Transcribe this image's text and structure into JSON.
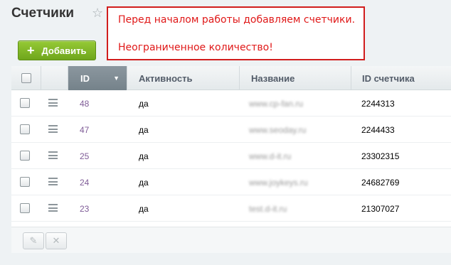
{
  "page": {
    "title": "Счетчики",
    "star_icon": "star-icon"
  },
  "callout": {
    "line1": "Перед началом работы добавляем счетчики.",
    "line2": "Неограниченное количество!"
  },
  "toolbar": {
    "add_label": "Добавить",
    "add_icon": "plus-icon"
  },
  "table": {
    "columns": [
      "ID",
      "Активность",
      "Название",
      "ID счетчика"
    ],
    "sorted_column": "ID",
    "rows": [
      {
        "id": "48",
        "active": "да",
        "name": "www.cp-fan.ru",
        "counter_id": "2244313"
      },
      {
        "id": "47",
        "active": "да",
        "name": "www.seoday.ru",
        "counter_id": "2244433"
      },
      {
        "id": "25",
        "active": "да",
        "name": "www.d-it.ru",
        "counter_id": "23302315"
      },
      {
        "id": "24",
        "active": "да",
        "name": "www.joykeys.ru",
        "counter_id": "24682769"
      },
      {
        "id": "23",
        "active": "да",
        "name": "test.d-it.ru",
        "counter_id": "21307027"
      }
    ]
  },
  "footer": {
    "edit_icon": "pencil-icon",
    "delete_icon": "close-icon"
  },
  "colors": {
    "add_button": "#7cb425",
    "callout_border": "#d11d1d",
    "callout_text": "#e01818",
    "id_link": "#7f5c97",
    "sorted_header": "#7d8a92"
  }
}
